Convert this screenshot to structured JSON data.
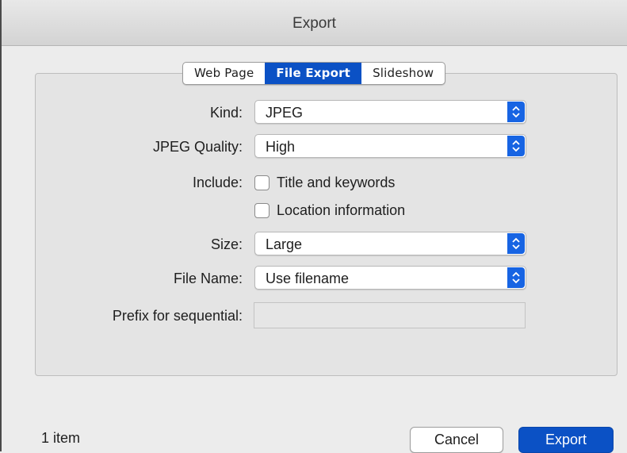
{
  "window": {
    "title": "Export"
  },
  "tabs": [
    {
      "label": "Web Page",
      "active": false
    },
    {
      "label": "File Export",
      "active": true
    },
    {
      "label": "Slideshow",
      "active": false
    }
  ],
  "form": {
    "kind": {
      "label": "Kind:",
      "value": "JPEG"
    },
    "jpeg_quality": {
      "label": "JPEG Quality:",
      "value": "High"
    },
    "include": {
      "label": "Include:",
      "options": [
        {
          "label": "Title and keywords",
          "checked": false
        },
        {
          "label": "Location information",
          "checked": false
        }
      ]
    },
    "size": {
      "label": "Size:",
      "value": "Large"
    },
    "file_name": {
      "label": "File Name:",
      "value": "Use filename"
    },
    "prefix": {
      "label": "Prefix for sequential:",
      "value": ""
    }
  },
  "footer": {
    "item_count": "1 item",
    "cancel_label": "Cancel",
    "export_label": "Export"
  },
  "icons": {
    "select_arrows": "chevron-up-down-icon"
  },
  "colors": {
    "accent": "#0b51c5",
    "select_arrow_bg": "#1764e3"
  }
}
